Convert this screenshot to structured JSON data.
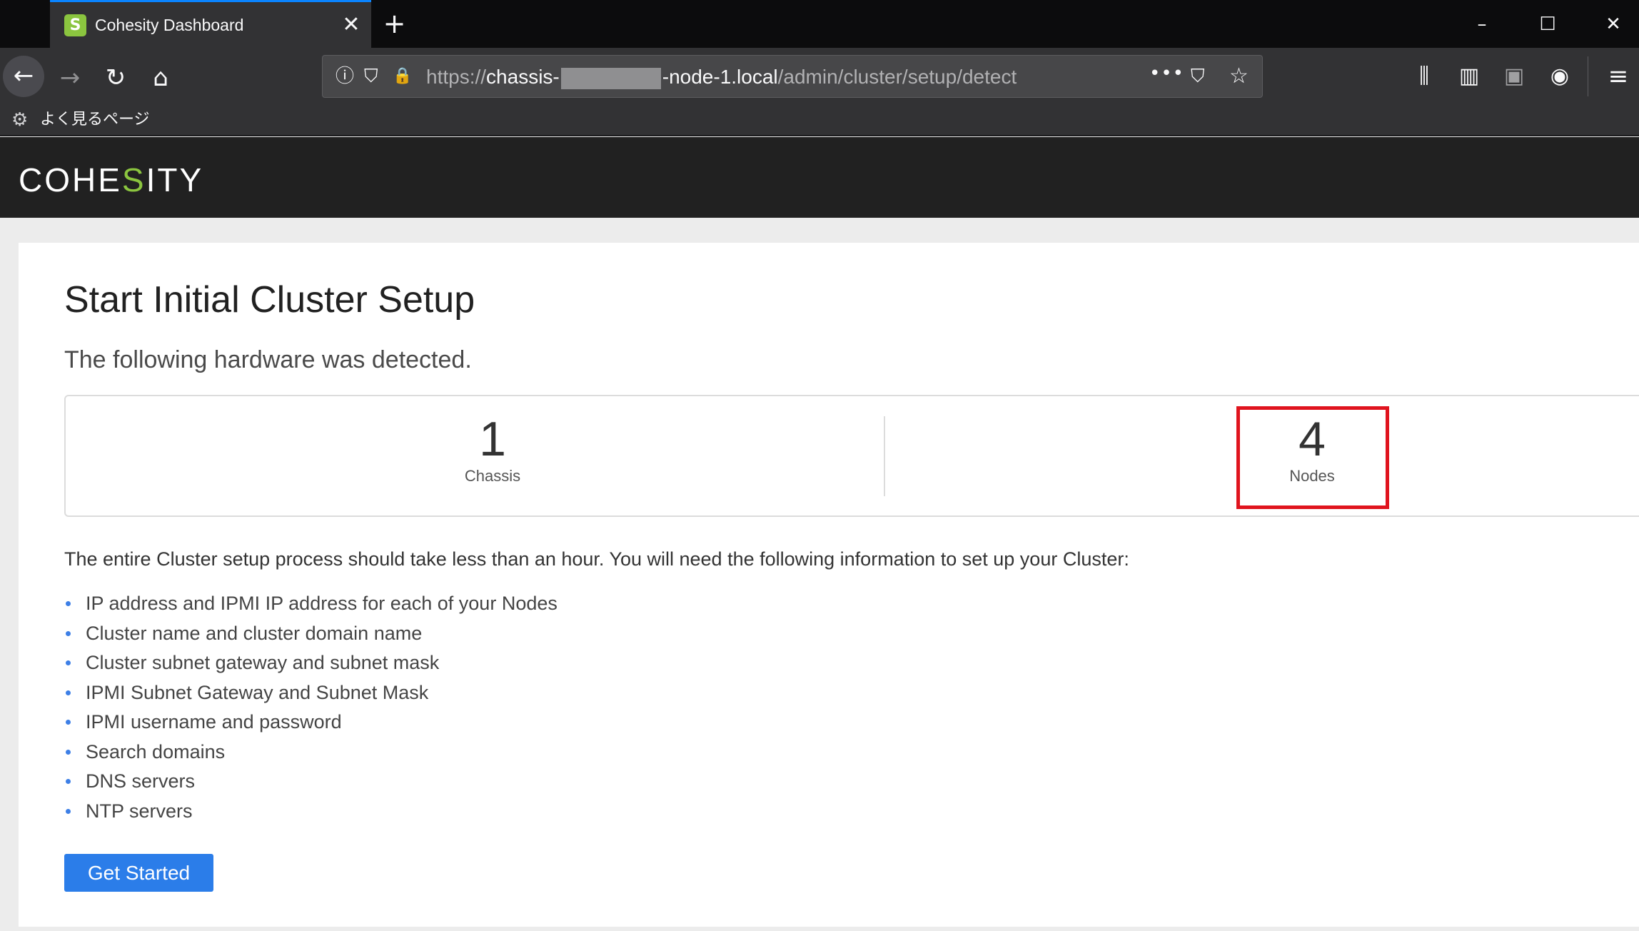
{
  "browser": {
    "tab": {
      "title": "Cohesity Dashboard",
      "favicon": "S",
      "close_glyph": "✕"
    },
    "new_tab_glyph": "+",
    "window_controls": {
      "minimize": "–",
      "maximize": "☐",
      "close": "✕"
    },
    "nav": {
      "back": "←",
      "forward": "→",
      "reload": "↻",
      "home": "⌂"
    },
    "url": {
      "scheme": "https://",
      "host_start": "chassis-",
      "host_end": "-node-1.local",
      "path": "/admin/cluster/setup/detect"
    },
    "url_icons": {
      "info": "ⓘ",
      "shield": "⛉",
      "lock": "🔒",
      "more": "•••",
      "pocket": "⛉",
      "star": "☆"
    },
    "toolbar_icons": {
      "library": "⫼",
      "sidebar": "▥",
      "extension": "▣",
      "account": "◉",
      "menu": "≡"
    },
    "bookmarks": {
      "icon": "⚙",
      "label": "よく見るページ"
    }
  },
  "header": {
    "logo_pre": "COHE",
    "logo_accent": "S",
    "logo_post": "ITY",
    "accent_color": "#8bc53f"
  },
  "setup": {
    "title": "Start Initial Cluster Setup",
    "subtitle": "The following hardware was detected.",
    "hardware": [
      {
        "value": "1",
        "label": "Chassis"
      },
      {
        "value": "4",
        "label": "Nodes"
      }
    ],
    "intro": "The entire Cluster setup process should take less than an hour. You will need the following information to set up your Cluster:",
    "requirements": [
      "IP address and IPMI IP address for each of your Nodes",
      "Cluster name and cluster domain name",
      "Cluster subnet gateway and subnet mask",
      "IPMI Subnet Gateway and Subnet Mask",
      "IPMI username and password",
      "Search domains",
      "DNS servers",
      "NTP servers"
    ],
    "button_label": "Get Started",
    "button_color": "#2b7de9",
    "highlight_color": "#e0141e"
  }
}
